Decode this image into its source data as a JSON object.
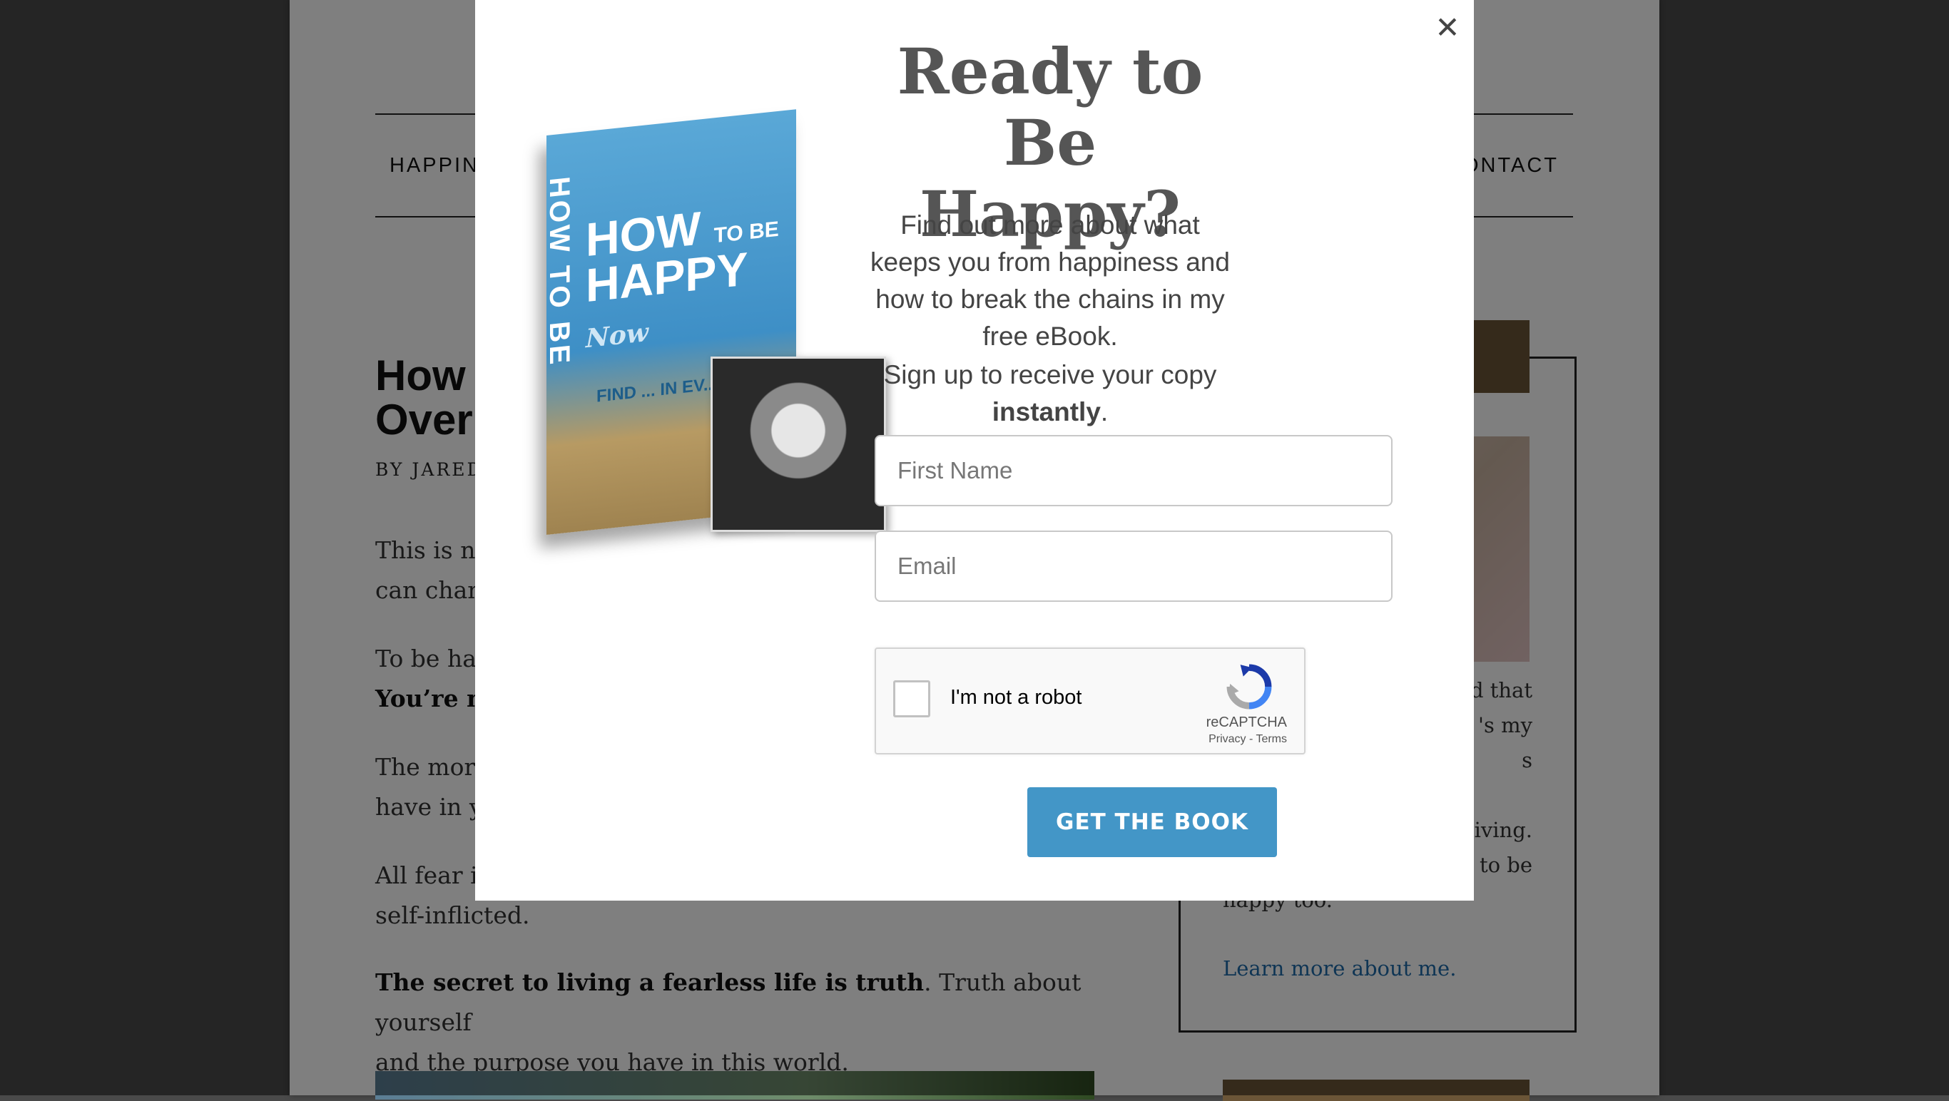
{
  "background": {
    "nav": {
      "left_item": "HAPPINE",
      "right_item": "ONTACT"
    },
    "post": {
      "title_line1": "How",
      "title_line2": "Over",
      "byline": "BY JARED",
      "paragraphs": [
        {
          "line1": "This is no",
          "line2": "can chan"
        },
        {
          "line1": "To be hap",
          "line2_bold": "You’re no"
        },
        {
          "line1": "The more",
          "line2": "have in y"
        },
        {
          "line1": "All fear is",
          "line2": "self-inflicted."
        }
      ],
      "truth_bold": "The secret to living a fearless life is truth",
      "truth_rest_1": ". Truth about yourself",
      "truth_rest_2": "and the purpose you have in this world."
    },
    "sidebar": {
      "lines": [
        "d that",
        "'s my",
        "s",
        "",
        "iving.",
        "to be",
        "happy too."
      ],
      "link": "Learn more about me."
    }
  },
  "modal": {
    "close_label": "✕",
    "book": {
      "spine": "HOW TO BE",
      "title_line1": "HOW",
      "title_line2": "HAPPY",
      "title_small": "TO BE",
      "title_script": "Now",
      "subtitle": "FIND ... IN EV..."
    },
    "title": "Ready to Be Happy?",
    "description": "Find out more about what keeps you from happiness and how to break the chains in my free eBook.",
    "signup_prefix": "Sign up to receive your copy ",
    "signup_bold": "instantly",
    "signup_suffix": ".",
    "first_name_placeholder": "First Name",
    "email_placeholder": "Email",
    "recaptcha": {
      "label": "I'm not a robot",
      "brand": "reCAPTCHA",
      "links": "Privacy - Terms"
    },
    "cta_label": "GET THE BOOK"
  },
  "colors": {
    "cta": "#4396c7",
    "overlay": "rgba(0,0,0,0.5)",
    "sidebar_accent": "#6b5537",
    "link": "#1e6aa8"
  }
}
